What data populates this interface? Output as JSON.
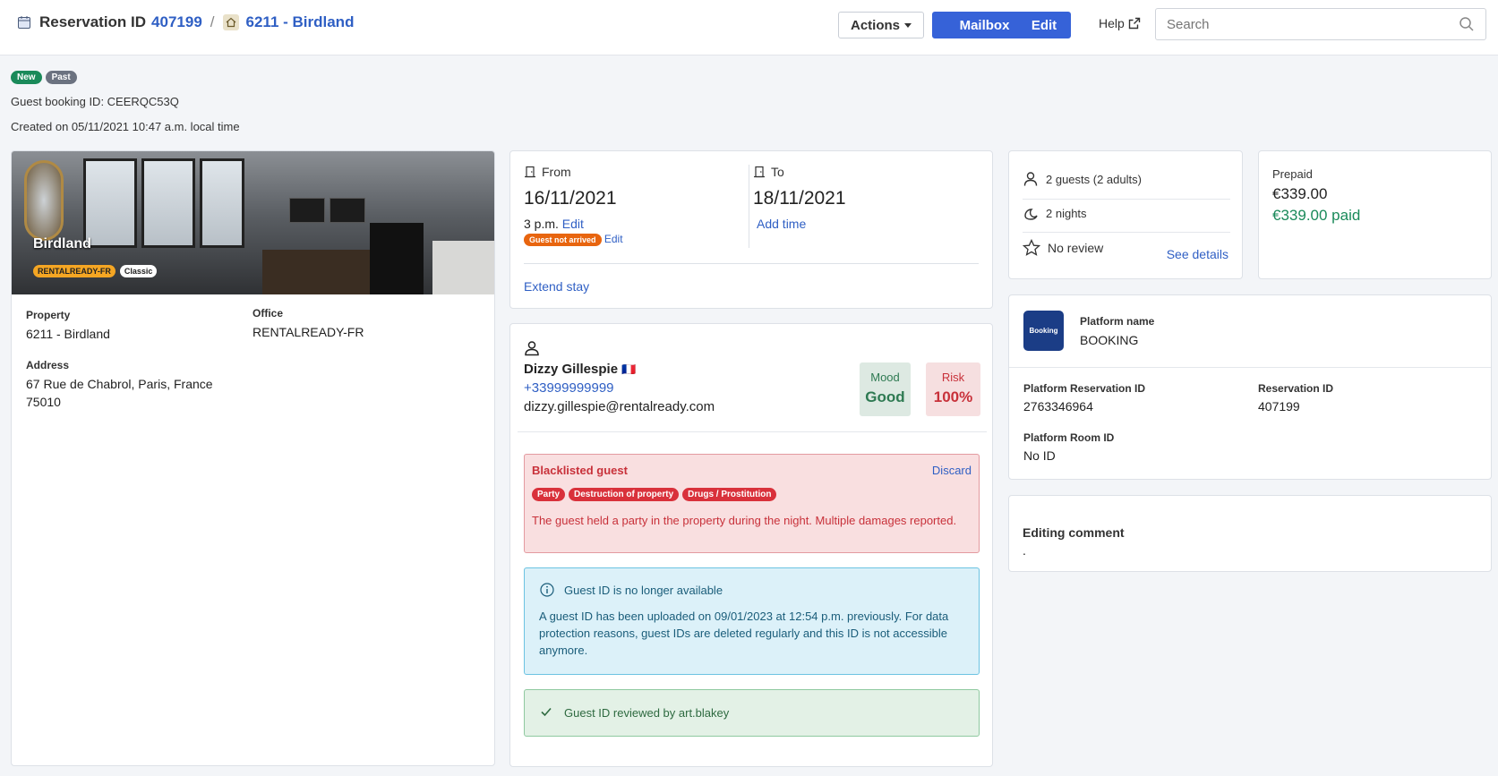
{
  "header": {
    "title": "Reservation ID",
    "reservation_id": "407199",
    "separator": "/",
    "property_link": "6211 - Birdland",
    "actions_label": "Actions",
    "mailbox_label": "Mailbox",
    "edit_label": "Edit",
    "help_label": "Help",
    "search_placeholder": "Search"
  },
  "status": {
    "badges": [
      "New",
      "Past"
    ],
    "guest_booking_id": "Guest booking ID: CEERQC53Q",
    "created": "Created on 05/11/2021 10:47 a.m. local time"
  },
  "property": {
    "name": "Birdland",
    "office_tag": "RENTALREADY-FR",
    "class_tag": "Classic",
    "property_label": "Property",
    "property_value": "6211 - Birdland",
    "office_label": "Office",
    "office_value": "RENTALREADY-FR",
    "address_label": "Address",
    "address_line1": "67 Rue de Chabrol, Paris, France",
    "address_line2": "75010"
  },
  "dates": {
    "from_label": "From",
    "from_date": "16/11/2021",
    "from_time": "3 p.m.",
    "from_edit": "Edit",
    "guest_status": "Guest not arrived",
    "status_edit": "Edit",
    "to_label": "To",
    "to_date": "18/11/2021",
    "add_time": "Add time",
    "extend_stay": "Extend stay"
  },
  "guest": {
    "name": "Dizzy Gillespie",
    "flag": "🇫🇷",
    "phone": "+33999999999",
    "email": "dizzy.gillespie@rentalready.com",
    "mood_label": "Mood",
    "mood_value": "Good",
    "risk_label": "Risk",
    "risk_value": "100%",
    "blacklist": {
      "title": "Blacklisted guest",
      "discard": "Discard",
      "reasons": [
        "Party",
        "Destruction of property",
        "Drugs / Prostitution"
      ],
      "description": "The guest held a party in the property during the night. Multiple damages reported."
    },
    "id_notice": {
      "title": "Guest ID is no longer available",
      "body": "A guest ID has been uploaded on 09/01/2023 at 12:54 p.m. previously. For data protection reasons, guest IDs are deleted regularly and this ID is not accessible anymore."
    },
    "id_review": "Guest ID reviewed by art.blakey"
  },
  "summary": {
    "guests": "2 guests (2 adults)",
    "nights": "2 nights",
    "review": "No review",
    "see_details": "See details"
  },
  "payment": {
    "label": "Prepaid",
    "amount": "€339.00",
    "paid": "€339.00 paid"
  },
  "platform": {
    "logo_text": "Booking",
    "name_label": "Platform name",
    "name_value": "BOOKING",
    "res_id_label": "Platform Reservation ID",
    "res_id_value": "2763346964",
    "rid_label": "Reservation ID",
    "rid_value": "407199",
    "room_label": "Platform Room ID",
    "room_value": "No ID"
  },
  "comment": {
    "label": "Editing comment",
    "value": "."
  },
  "colors": {
    "accent": "#3662d8",
    "link": "#2f5fc4",
    "success": "#1a8a5a",
    "danger": "#c8313a",
    "warning": "#e8650f"
  }
}
